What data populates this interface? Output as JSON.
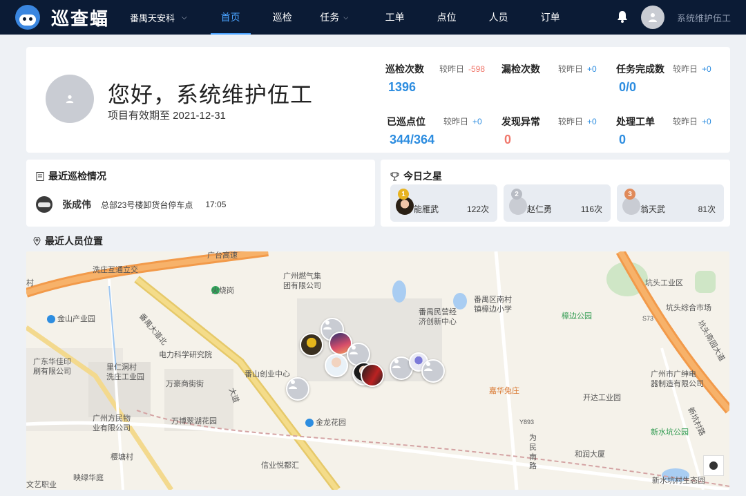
{
  "app": {
    "name": "巡查蝠",
    "project": "番禺天安科"
  },
  "nav": [
    "首页",
    "巡检",
    "任务",
    "工单",
    "点位",
    "人员",
    "订单"
  ],
  "user": {
    "name": "系统维护伍工"
  },
  "welcome": {
    "greeting": "您好，系统维护伍工",
    "expiry": "项目有效期至 2021-12-31"
  },
  "stats": [
    {
      "label": "巡检次数",
      "compare": "较昨日",
      "delta": "-598",
      "value": "1396",
      "delta_color": "#f0776b",
      "value_color": "#2d8de0"
    },
    {
      "label": "漏检次数",
      "compare": "较昨日",
      "delta": "+0",
      "value": "",
      "delta_color": "#2d8de0",
      "value_color": "#2d8de0"
    },
    {
      "label": "任务完成数",
      "compare": "较昨日",
      "delta": "+0",
      "value": "0/0",
      "delta_color": "#2d8de0",
      "value_color": "#2d8de0"
    },
    {
      "label": "已巡点位",
      "compare": "较昨日",
      "delta": "+0",
      "value": "344/364",
      "delta_color": "#2d8de0",
      "value_color": "#2d8de0"
    },
    {
      "label": "发现异常",
      "compare": "较昨日",
      "delta": "+0",
      "value": "0",
      "delta_color": "#2d8de0",
      "value_color": "#f0776b"
    },
    {
      "label": "处理工单",
      "compare": "较昨日",
      "delta": "+0",
      "value": "0",
      "delta_color": "#2d8de0",
      "value_color": "#2d8de0"
    }
  ],
  "recent": {
    "title": "最近巡检情况",
    "rows": [
      {
        "name": "张成伟",
        "location": "总部23号楼卸货台停车点",
        "time": "17:05"
      }
    ]
  },
  "stars": {
    "title": "今日之星",
    "items": [
      {
        "rank": "1",
        "name": "能雁武",
        "count": "122次",
        "medal_color": "#e8b320"
      },
      {
        "rank": "2",
        "name": "赵仁勇",
        "count": "116次",
        "medal_color": "#b8bcc4"
      },
      {
        "rank": "3",
        "name": "翁天武",
        "count": "81次",
        "medal_color": "#e08a5a"
      }
    ]
  },
  "location": {
    "title": "最近人员位置"
  },
  "map": {
    "labels": [
      "广台高速",
      "洗庄互通立交",
      "广州燃气集\n团有限公司",
      "火烧岗",
      "番禺大道北",
      "金山产业园",
      "番禺民营经\n济创新中心",
      "番禺区南村\n镇樟边小学",
      "樟边公园",
      "坑头工业区",
      "坑头综合市场",
      "坑头南园大道",
      "S73",
      "广东华佳印\n刷有限公司",
      "里仁洞村\n洗庄工业园",
      "电力科学研究院",
      "万豪商街街",
      "番山创业中心",
      "大道",
      "广州方民物\n业有限公司",
      "万博翠湖花园",
      "金龙花园",
      "嘉华兔庄",
      "开达工业园",
      "广州市广绅电\n器制造有限公司",
      "新水坑公园",
      "新坑村路",
      "和润大厦",
      "Y893",
      "为民南路",
      "信业悦都汇",
      "映绿华庭",
      "文艺职业",
      "新水坑村生态园",
      "樱塘村",
      "村"
    ]
  }
}
